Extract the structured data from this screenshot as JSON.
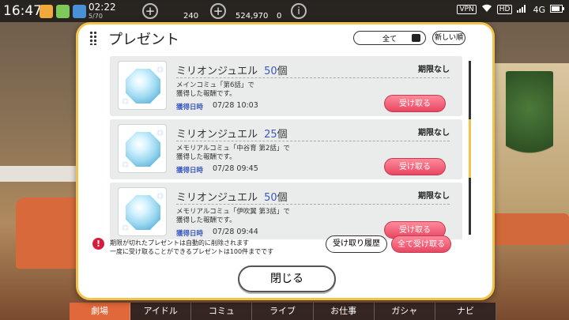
{
  "status_bar": {
    "time": "16:47",
    "game_time": "02:22",
    "game_sub": "5/70",
    "currency_a": "240",
    "currency_b": "524,970",
    "currency_c": "0",
    "info_icon": "i",
    "vpn": "VPN",
    "hd": "HD",
    "network": "4G"
  },
  "dialog": {
    "title": "プレゼント",
    "filter_value": "全て",
    "sort_label": "新しい順",
    "items": [
      {
        "name": "ミリオンジュエル",
        "count": "50",
        "unit": "個",
        "expiry": "期限なし",
        "desc_line1": "メインコミュ「第6話」で",
        "desc_line2": "獲得した報酬です。",
        "received_label": "獲得日時",
        "received_date": "07/28 10:03",
        "receive_label": "受け取る"
      },
      {
        "name": "ミリオンジュエル",
        "count": "25",
        "unit": "個",
        "expiry": "期限なし",
        "desc_line1": "メモリアルコミュ「中谷育 第2話」で",
        "desc_line2": "獲得した報酬です。",
        "received_label": "獲得日時",
        "received_date": "07/28 09:45",
        "receive_label": "受け取る"
      },
      {
        "name": "ミリオンジュエル",
        "count": "50",
        "unit": "個",
        "expiry": "期限なし",
        "desc_line1": "メモリアルコミュ「伊吹翼 第3話」で",
        "desc_line2": "獲得した報酬です。",
        "received_label": "獲得日時",
        "received_date": "07/28 09:44",
        "receive_label": "受け取る"
      }
    ],
    "notice_icon": "!",
    "notice_line1": "期限が切れたプレゼントは自動的に削除されます",
    "notice_line2": "一度に受け取ることができるプレゼントは100件までです",
    "history_label": "受け取り履歴",
    "receive_all_label": "全て受け取る",
    "close_label": "閉じる"
  },
  "bottom_nav": {
    "items": [
      "劇場",
      "アイドル",
      "コミュ",
      "ライブ",
      "お仕事",
      "ガシャ",
      "ナビ"
    ]
  },
  "colors": {
    "accent_pink": "#e94763",
    "frame_yellow": "#f2c24a",
    "count_blue": "#3b58c0"
  }
}
